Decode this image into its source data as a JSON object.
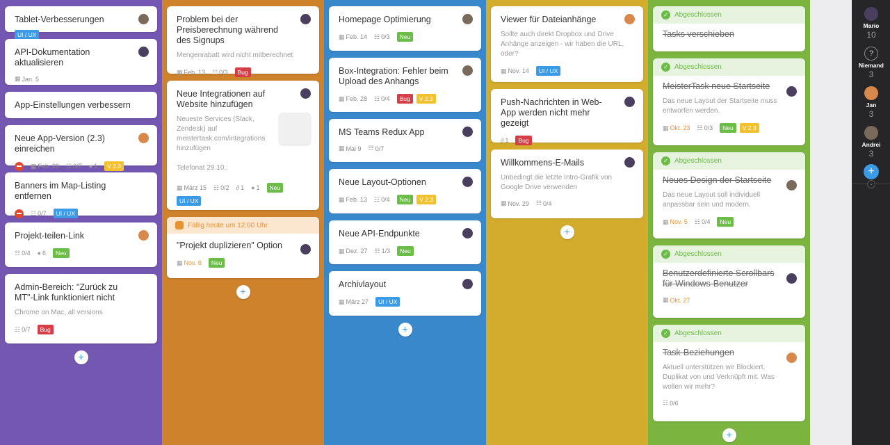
{
  "colors": {
    "col1": "#7457b0",
    "col2": "#cf822c",
    "col3": "#3a88cc",
    "col4": "#d4ac2d",
    "col5": "#7cb440"
  },
  "columns": [
    {
      "cards": [
        {
          "title": "Tablet-Verbesserungen",
          "badges": [
            "UI / UX"
          ]
        },
        {
          "title": "API-Dokumentation aktualisieren",
          "date": "Jan. 5"
        },
        {
          "title": "App-Einstellungen verbessern"
        },
        {
          "title": "Neue App-Version (2.3) einreichen",
          "date": "Feb. 28",
          "checklist": "0/7",
          "comments": "1",
          "badges": [
            "V 2.3"
          ]
        },
        {
          "title": "Banners im Map-Listing entfernen",
          "checklist": "0/7",
          "badges": [
            "UI / UX"
          ]
        },
        {
          "title": "Projekt-teilen-Link",
          "checklist": "0/4",
          "comments": "6",
          "badges": [
            "Neu"
          ]
        },
        {
          "title": "Admin-Bereich: \"Zurück zu MT\"-Link funktioniert nicht",
          "desc": "Chrome on Mac, all versions",
          "checklist": "0/7",
          "badges": [
            "Bug"
          ]
        }
      ]
    },
    {
      "cards": [
        {
          "title": "Problem bei der Preisberechnung während des Signups",
          "desc": "Mengenrabatt wird nicht mitberechnet",
          "date": "Feb. 13",
          "checklist": "0/3",
          "badges": [
            "Bug"
          ]
        },
        {
          "title": "Neue Integrationen auf Website hinzufügen",
          "desc": "Neueste Services (Slack, Zendesk) auf meistertask.com/integrations hinzufügen",
          "desc2": "Telefonat 29.10.:",
          "date": "März 15",
          "checklist": "0/2",
          "attachments": "1",
          "comments": "1",
          "badges": [
            "Neu",
            "UI / UX"
          ]
        },
        {
          "due": "Fällig heute um 12:00 Uhr",
          "title": "\"Projekt duplizieren\" Option",
          "date": "Nov. 6",
          "badges": [
            "Neu"
          ]
        }
      ]
    },
    {
      "cards": [
        {
          "title": "Homepage Optimierung",
          "date": "Feb. 14",
          "checklist": "0/3",
          "badges": [
            "Neu"
          ]
        },
        {
          "title": "Box-Integration: Fehler beim Upload des Anhangs",
          "date": "Feb. 28",
          "checklist": "0/4",
          "badges": [
            "Bug",
            "V 2.3"
          ]
        },
        {
          "title": "MS Teams Redux App",
          "date": "Mai 9",
          "checklist": "0/7"
        },
        {
          "title": "Neue Layout-Optionen",
          "date": "Feb. 13",
          "checklist": "0/4",
          "badges": [
            "Neu",
            "V 2.3"
          ]
        },
        {
          "title": "Neue API-Endpunkte",
          "date": "Dez. 27",
          "checklist": "1/3",
          "badges": [
            "Neu"
          ]
        },
        {
          "title": "Archivlayout",
          "date": "März 27",
          "badges": [
            "UI / UX"
          ]
        }
      ]
    },
    {
      "cards": [
        {
          "title": "Viewer für Dateianhänge",
          "desc": "Sollte auch direkt Dropbox und Drive Anhänge anzeigen - wir haben die URL, oder?",
          "date": "Nov. 14",
          "badges": [
            "UI / UX"
          ]
        },
        {
          "title": "Push-Nachrichten in Web-App werden nicht mehr gezeigt",
          "attachments": "1",
          "badges": [
            "Bug"
          ]
        },
        {
          "title": "Willkommens-E-Mails",
          "desc": "Unbedingt die letzte Intro-Grafik von Google Drive verwenden",
          "date": "Nov. 29",
          "checklist": "0/4"
        }
      ]
    },
    {
      "done_label": "Abgeschlossen",
      "cards": [
        {
          "title": "Tasks verschieben"
        },
        {
          "title": "MeisterTask neue Startseite",
          "desc": "Das neue Layout der Startseite muss entworfen werden.",
          "date": "Okt. 23",
          "checklist": "0/3",
          "badges": [
            "Neu",
            "V 2.3"
          ]
        },
        {
          "title": "Neues Design der Startseite",
          "desc": "Das neue Layout soll individuell anpassbar sein und modern.",
          "date": "Nov. 5",
          "checklist": "0/4",
          "badges": [
            "Neu"
          ]
        },
        {
          "title": "Benutzerdefinierte Scrollbars für Windows-Benutzer",
          "date": "Okt. 27"
        },
        {
          "title": "Task-Beziehungen",
          "desc": "Aktuell unterstützen wir Blockiert, Duplikat von und Verknüpft mit. Was wollen wir mehr?",
          "checklist": "0/6"
        }
      ]
    }
  ],
  "sidebar": {
    "users": [
      {
        "name": "Mario",
        "count": "10"
      },
      {
        "name": "Niemand",
        "count": "3"
      },
      {
        "name": "Jan",
        "count": "3"
      },
      {
        "name": "Andrei",
        "count": "3"
      }
    ],
    "add_label": "+"
  },
  "add_label": "+"
}
